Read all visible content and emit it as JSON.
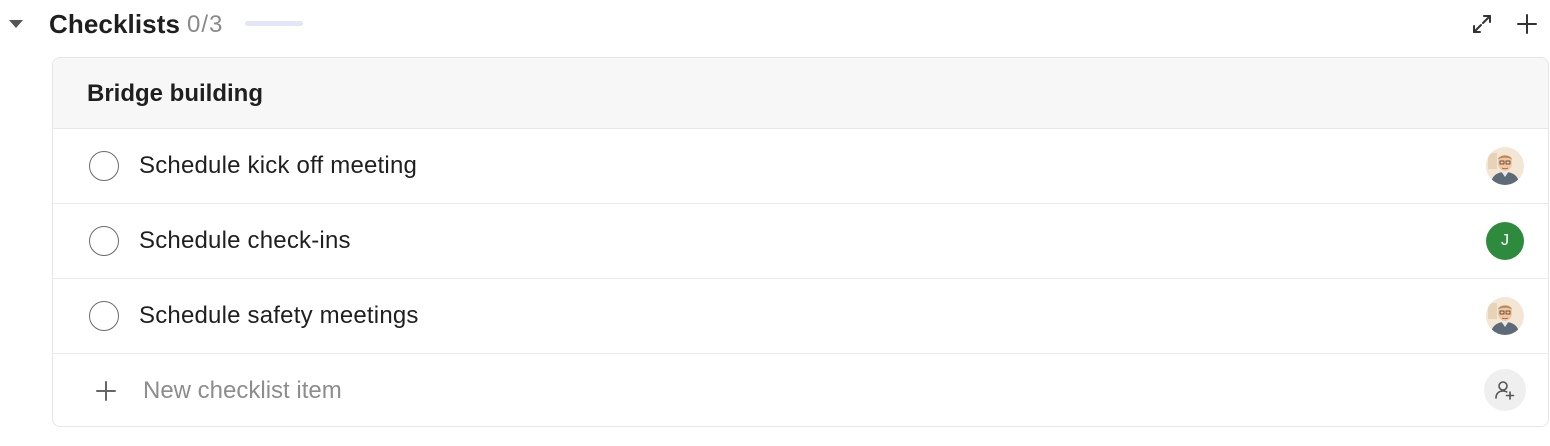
{
  "section": {
    "title": "Checklists",
    "count": "0/3",
    "progress_fraction": 0,
    "toggle_icon": "caret-down-icon",
    "expand_icon": "expand-icon",
    "add_icon": "plus-icon"
  },
  "checklist": {
    "title": "Bridge building",
    "items": [
      {
        "label": "Schedule kick off meeting",
        "checked": false,
        "assignee": {
          "type": "photo",
          "icon": "person-photo-avatar"
        }
      },
      {
        "label": "Schedule check-ins",
        "checked": false,
        "assignee": {
          "type": "initial",
          "initial": "J",
          "color": "#2e8b3e"
        }
      },
      {
        "label": "Schedule safety meetings",
        "checked": false,
        "assignee": {
          "type": "photo",
          "icon": "person-photo-avatar"
        }
      }
    ],
    "new_item": {
      "placeholder": "New checklist item",
      "plus_icon": "plus-icon",
      "assign_icon": "assign-user-icon"
    }
  },
  "colors": {
    "progress_track": "#e4e6f7",
    "progress_fill": "#6b74d9",
    "header_bg": "#f7f7f7",
    "avatar_green": "#2e8b3e"
  }
}
